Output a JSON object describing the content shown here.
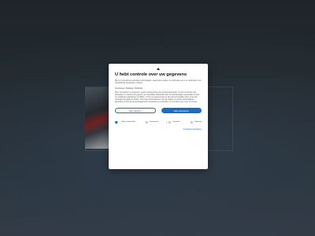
{
  "dialog": {
    "title": "U hebt controle over uw gegevens",
    "intro": "Wij en onze partners gebruiken technologieën, waaronder cookies, om informatie over u te verzamelen voor verschillende doeleinden, inclusief:",
    "purposes": "Functioneel, Statistiek, Publiciteit",
    "body": "Door 'Accepteren' te selecteren, geeft u toestemming voor al deze doeleinden. U kunt uw keuzes ook aanpassen en toestemming geven voor specifieke doeleinden door de selectievakjes te gebruiken of door op 'Instellingen aanpassen' te klikken. U kunt uw toestemming op elk moment intrekken door op de link onderaan de pagina te klikken. Voor meer informatie over hoe wij cookies en andere technologieën gebruiken en hoe wij persoonsgegevens verzamelen en verwerken, zie ons",
    "body_link": "Meer",
    "privacy_link": "lees meer en privacy",
    "reject_label": "Alles afwijzen",
    "accept_label": "Alles accepteren",
    "toggles": [
      {
        "label": "Strikt noodzakelijk",
        "on": true
      },
      {
        "label": "Functioneel",
        "on": false
      },
      {
        "label": "Statistiek",
        "on": false
      },
      {
        "label": "Publiciteit",
        "on": false
      }
    ],
    "settings_label": "Instellingen aanpassen"
  }
}
